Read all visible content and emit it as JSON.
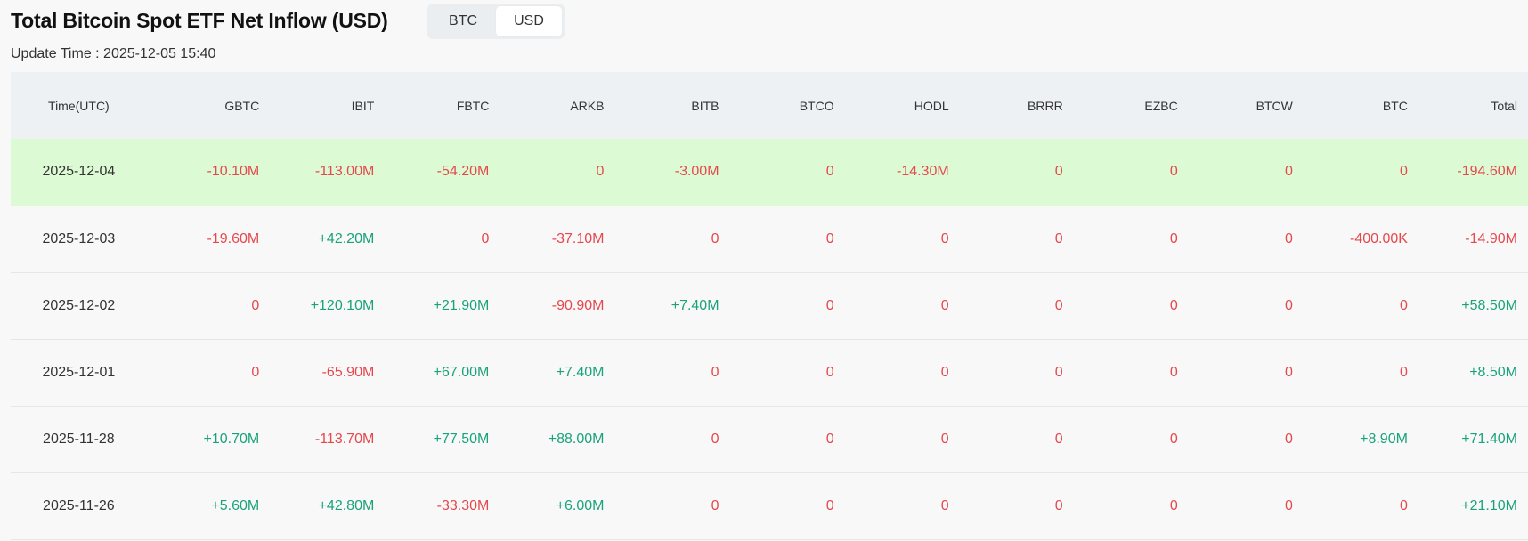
{
  "header": {
    "title": "Total Bitcoin Spot ETF Net Inflow (USD)",
    "toggle": {
      "btc_label": "BTC",
      "usd_label": "USD",
      "selected": "USD"
    },
    "update_time": "Update Time : 2025-12-05 15:40"
  },
  "colors": {
    "negative": "#e5484d",
    "positive": "#1aa37a",
    "highlight_row": "#dcfad3",
    "header_bg": "#eef1f4"
  },
  "table": {
    "columns": [
      "Time(UTC)",
      "GBTC",
      "IBIT",
      "FBTC",
      "ARKB",
      "BITB",
      "BTCO",
      "HODL",
      "BRRR",
      "EZBC",
      "BTCW",
      "BTC",
      "Total"
    ],
    "rows": [
      [
        "2025-12-04",
        "-10.10M",
        "-113.00M",
        "-54.20M",
        "0",
        "-3.00M",
        "0",
        "-14.30M",
        "0",
        "0",
        "0",
        "0",
        "-194.60M"
      ],
      [
        "2025-12-03",
        "-19.60M",
        "+42.20M",
        "0",
        "-37.10M",
        "0",
        "0",
        "0",
        "0",
        "0",
        "0",
        "-400.00K",
        "-14.90M"
      ],
      [
        "2025-12-02",
        "0",
        "+120.10M",
        "+21.90M",
        "-90.90M",
        "+7.40M",
        "0",
        "0",
        "0",
        "0",
        "0",
        "0",
        "+58.50M"
      ],
      [
        "2025-12-01",
        "0",
        "-65.90M",
        "+67.00M",
        "+7.40M",
        "0",
        "0",
        "0",
        "0",
        "0",
        "0",
        "0",
        "+8.50M"
      ],
      [
        "2025-11-28",
        "+10.70M",
        "-113.70M",
        "+77.50M",
        "+88.00M",
        "0",
        "0",
        "0",
        "0",
        "0",
        "0",
        "+8.90M",
        "+71.40M"
      ],
      [
        "2025-11-26",
        "+5.60M",
        "+42.80M",
        "-33.30M",
        "+6.00M",
        "0",
        "0",
        "0",
        "0",
        "0",
        "0",
        "0",
        "+21.10M"
      ]
    ],
    "highlighted_row_index": 0
  }
}
